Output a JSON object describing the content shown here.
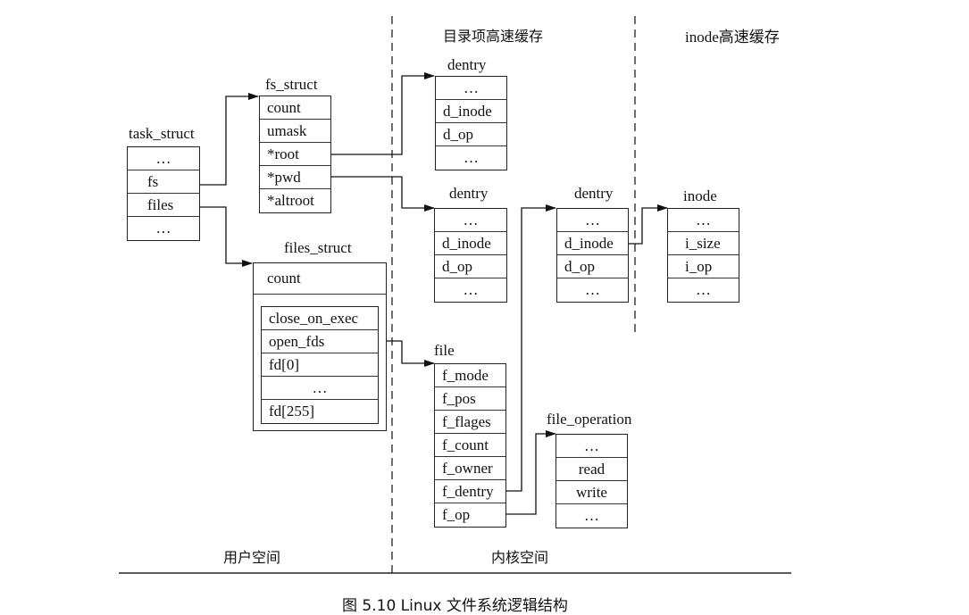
{
  "regions": {
    "dentry_cache": "目录项高速缓存",
    "inode_cache": "inode高速缓存",
    "user_space": "用户空间",
    "kernel_space": "内核空间"
  },
  "caption": "图 5.10   Linux 文件系统逻辑结构",
  "structs": {
    "task_struct": {
      "title": "task_struct",
      "fields": [
        "…",
        "fs",
        "files",
        "…"
      ]
    },
    "fs_struct": {
      "title": "fs_struct",
      "fields": [
        "count",
        "umask",
        "*root",
        "*pwd",
        "*altroot"
      ]
    },
    "files_struct": {
      "title": "files_struct",
      "count": "count",
      "fields": [
        "close_on_exec",
        "open_fds",
        "fd[0]",
        "…",
        "fd[255]"
      ]
    },
    "dentry_root": {
      "title": "dentry",
      "fields": [
        "…",
        "d_inode",
        "d_op",
        "…"
      ]
    },
    "dentry_pwd": {
      "title": "dentry",
      "fields": [
        "…",
        "d_inode",
        "d_op",
        "…"
      ]
    },
    "dentry_file": {
      "title": "dentry",
      "fields": [
        "…",
        "d_inode",
        "d_op",
        "…"
      ]
    },
    "inode": {
      "title": "inode",
      "fields": [
        "…",
        "i_size",
        "i_op",
        "…"
      ]
    },
    "file": {
      "title": "file",
      "fields": [
        "f_mode",
        "f_pos",
        "f_flages",
        "f_count",
        "f_owner",
        "f_dentry",
        "f_op"
      ]
    },
    "file_operation": {
      "title": "file_operation",
      "fields": [
        "…",
        "read",
        "write",
        "…"
      ]
    }
  }
}
